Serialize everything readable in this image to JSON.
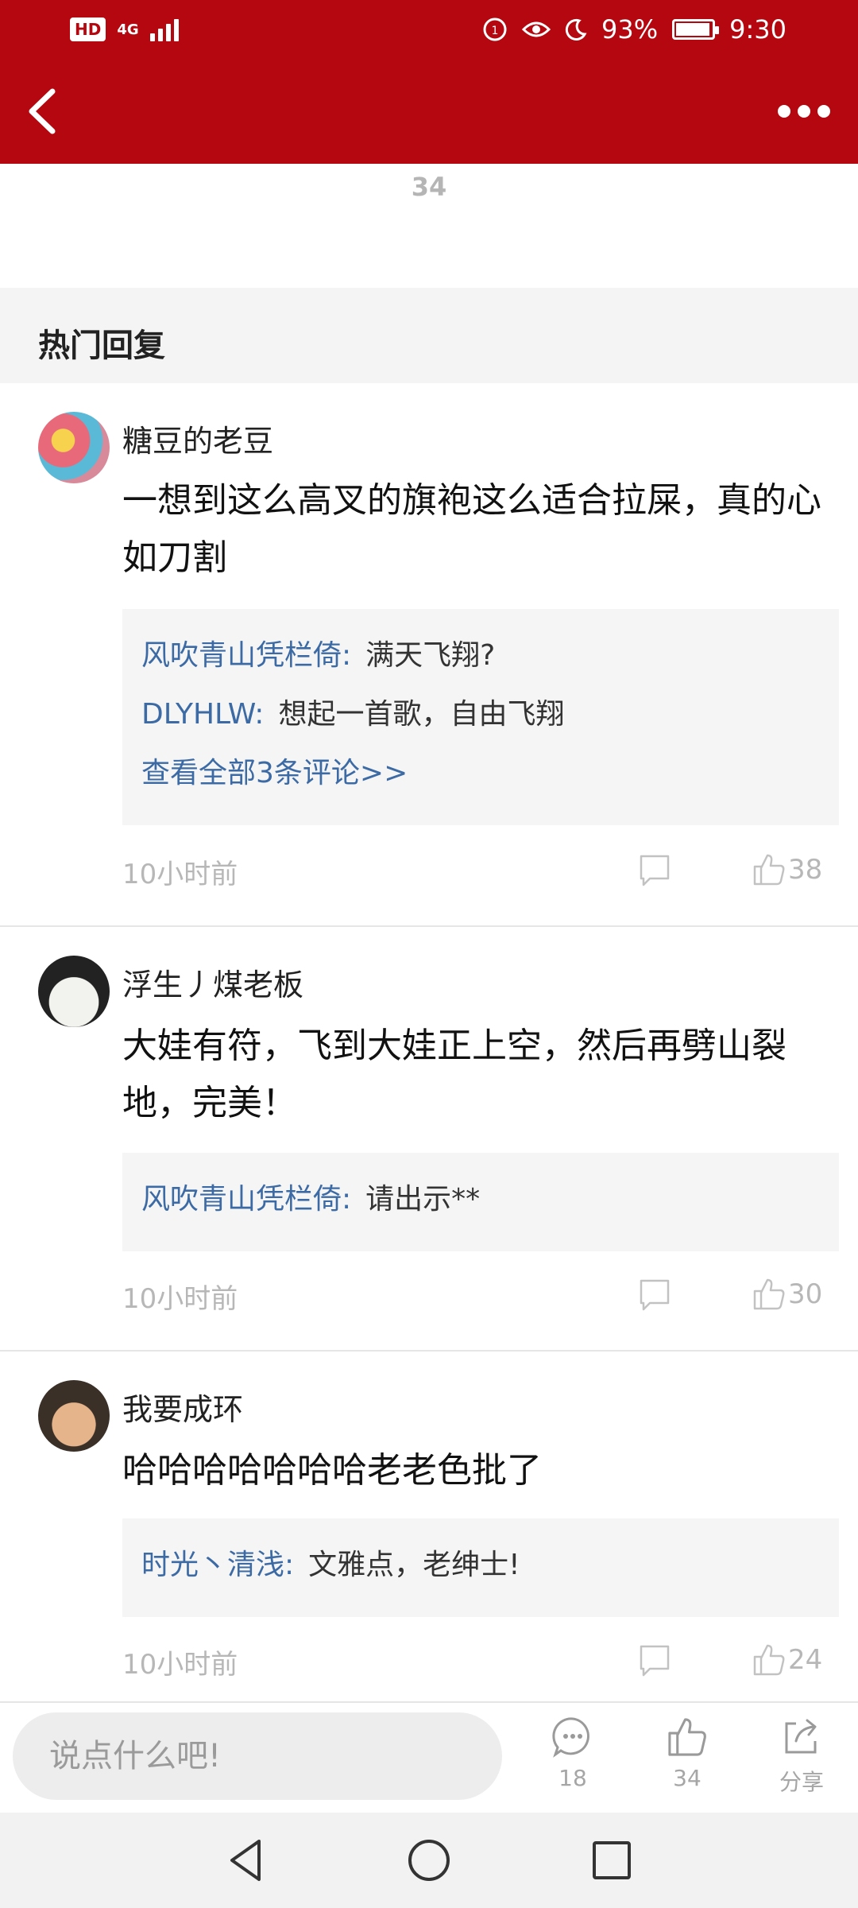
{
  "status": {
    "percent": "93%",
    "time": "9:30",
    "hd": "HD",
    "network": "4G"
  },
  "top_like_count": "34",
  "section": {
    "title": "热门回复"
  },
  "comments": [
    {
      "author": "糖豆的老豆",
      "content": "一想到这么高叉的旗袍这么适合拉屎，真的心如刀割",
      "replies": [
        {
          "name": "风吹青山凭栏倚:",
          "text": "满天飞翔?"
        },
        {
          "name": "DLYHLW:",
          "text": "想起一首歌，自由飞翔"
        }
      ],
      "view_all": "查看全部3条评论>>",
      "time": "10小时前",
      "likes": "38",
      "avatar_colors": [
        "#e86a7a",
        "#f3c24a",
        "#5ab9d6"
      ]
    },
    {
      "author": "浮生丿煤老板",
      "content": "大娃有符，飞到大娃正上空，然后再劈山裂地，完美！",
      "replies": [
        {
          "name": "风吹青山凭栏倚:",
          "text": "请出示**"
        }
      ],
      "time": "10小时前",
      "likes": "30",
      "avatar_colors": [
        "#2a2a2a",
        "#efefef"
      ]
    },
    {
      "author": "我要成环",
      "content": "哈哈哈哈哈哈哈老老色批了",
      "replies": [
        {
          "name": "时光丶清浅:",
          "text": "文雅点，老绅士!"
        }
      ],
      "time": "10小时前",
      "likes": "24",
      "avatar_colors": [
        "#3a3028",
        "#e6b48a"
      ]
    }
  ],
  "bottom": {
    "input_placeholder": "说点什么吧!",
    "comment_count": "18",
    "like_count": "34",
    "share_label": "分享"
  },
  "colors": {
    "brand_red": "#B5070F",
    "link_blue": "#3c6aa4"
  }
}
